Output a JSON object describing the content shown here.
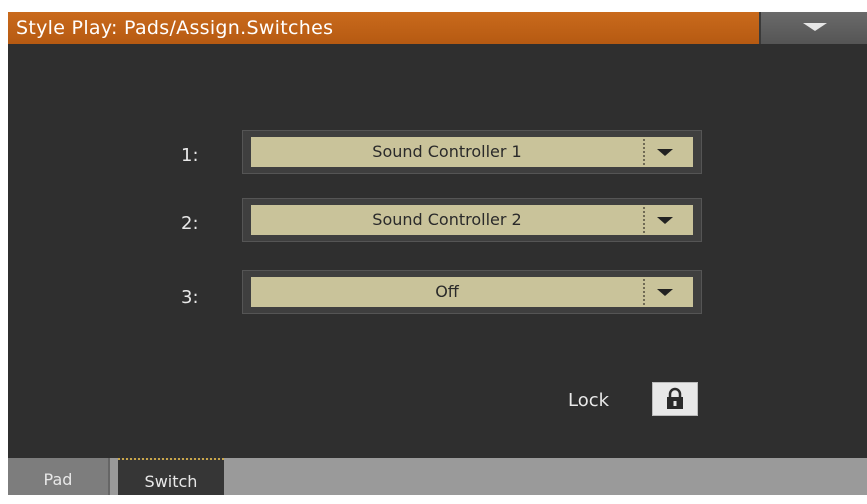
{
  "header": {
    "title": "Style Play: Pads/Assign.Switches",
    "menu_icon": "triangle-down-icon"
  },
  "assignments": [
    {
      "label": "1:",
      "value": "Sound Controller 1"
    },
    {
      "label": "2:",
      "value": "Sound Controller 2"
    },
    {
      "label": "3:",
      "value": "Off"
    }
  ],
  "lock": {
    "label": "Lock",
    "icon": "padlock-icon"
  },
  "tabs": [
    {
      "label": "Pad",
      "selected": false
    },
    {
      "label": "Switch",
      "selected": true
    }
  ],
  "colors": {
    "title_bar": "#b65a12",
    "background": "#2f2f2f",
    "dropdown_field": "#c9c39a",
    "tab_bar": "#9a9a9a"
  }
}
